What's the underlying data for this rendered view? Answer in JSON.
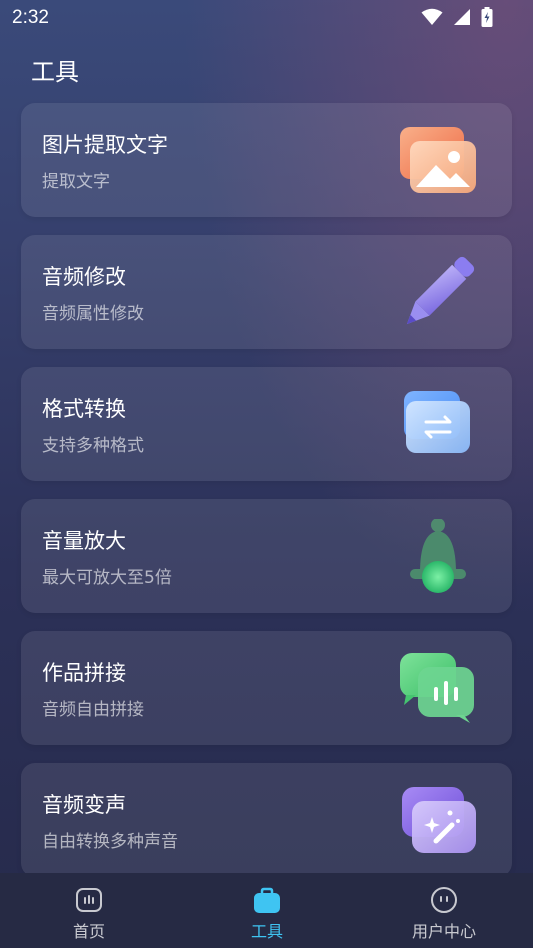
{
  "status": {
    "time": "2:32"
  },
  "page": {
    "title": "工具"
  },
  "tools": [
    {
      "title": "图片提取文字",
      "subtitle": "提取文字",
      "icon": "image-icon"
    },
    {
      "title": "音频修改",
      "subtitle": "音频属性修改",
      "icon": "pencil-icon"
    },
    {
      "title": "格式转换",
      "subtitle": "支持多种格式",
      "icon": "convert-icon"
    },
    {
      "title": "音量放大",
      "subtitle": "最大可放大至5倍",
      "icon": "bell-icon"
    },
    {
      "title": "作品拼接",
      "subtitle": "音频自由拼接",
      "icon": "chat-audio-icon"
    },
    {
      "title": "音频变声",
      "subtitle": "自由转换多种声音",
      "icon": "magic-wand-icon"
    }
  ],
  "nav": {
    "items": [
      {
        "label": "首页",
        "icon": "home-icon",
        "active": false
      },
      {
        "label": "工具",
        "icon": "toolbox-icon",
        "active": true
      },
      {
        "label": "用户中心",
        "icon": "user-center-icon",
        "active": false
      }
    ],
    "active_color": "#3fc4f2"
  }
}
